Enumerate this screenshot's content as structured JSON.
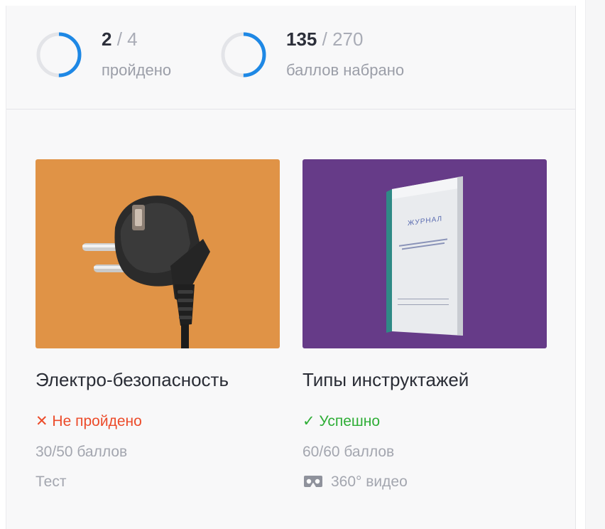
{
  "stats": {
    "passed": {
      "done": "2",
      "sep": " / ",
      "total": "4",
      "caption": "пройдено",
      "progress": 0.5
    },
    "points": {
      "done": "135",
      "sep": " / ",
      "total": "270",
      "caption": "баллов набрано",
      "progress": 0.5
    }
  },
  "cards": [
    {
      "title": "Электро-безопасность",
      "status_icon": "cross-icon",
      "status": "✕ Не пройдено",
      "points": "30/50 баллов",
      "type": "Тест",
      "thumb_color": "#e09346"
    },
    {
      "title": "Типы инструктажей",
      "status_icon": "check-icon",
      "status": "✓ Успешно",
      "points": "60/60 баллов",
      "type": "360° видео",
      "type_icon": "vr-headset-icon",
      "thumb_color": "#663b88",
      "book_title": "ЖУРНАЛ"
    }
  ],
  "colors": {
    "accent": "#1e88e5",
    "ring_track": "#e3e4e8",
    "fail": "#ec4b2a",
    "success": "#2fae37"
  }
}
